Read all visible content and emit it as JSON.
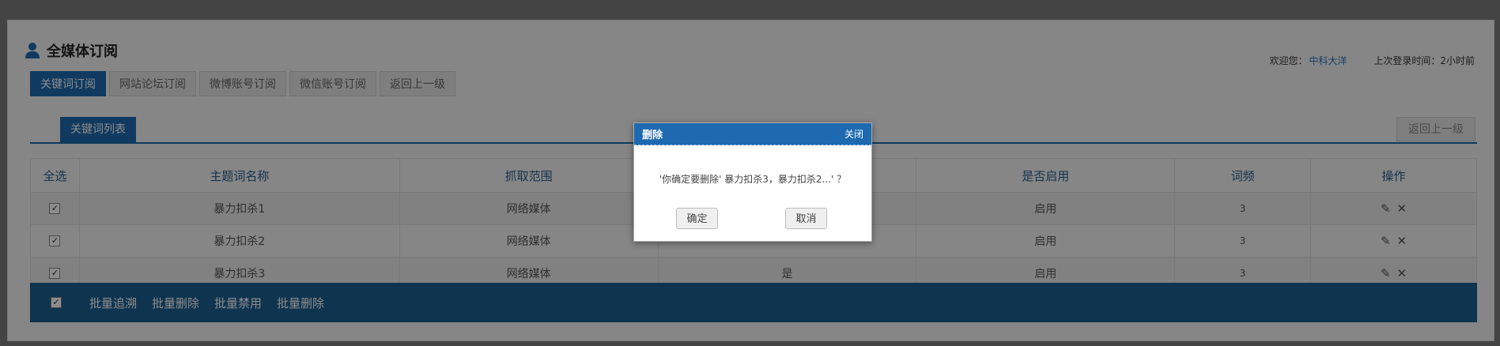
{
  "header": {
    "title": "全媒体订阅",
    "welcome_label": "欢迎您：",
    "username": "中科大洋",
    "last_login": "上次登录时间：2小时前"
  },
  "tabs": [
    {
      "label": "关键词订阅",
      "active": true
    },
    {
      "label": "网站论坛订阅",
      "active": false
    },
    {
      "label": "微博账号订阅",
      "active": false
    },
    {
      "label": "微信账号订阅",
      "active": false
    },
    {
      "label": "返回上一级",
      "active": false
    }
  ],
  "subbar": {
    "tab_label": "关键词列表",
    "back_label": "返回上一级"
  },
  "table": {
    "headers": [
      "全选",
      "主题词名称",
      "抓取范围",
      "",
      "是否启用",
      "词频",
      "操作"
    ],
    "rows": [
      {
        "checked": true,
        "name": "暴力扣杀1",
        "scope": "网络媒体",
        "col4": "",
        "enabled": "启用",
        "freq": "3"
      },
      {
        "checked": true,
        "name": "暴力扣杀2",
        "scope": "网络媒体",
        "col4": "",
        "enabled": "启用",
        "freq": "3"
      },
      {
        "checked": true,
        "name": "暴力扣杀3",
        "scope": "网络媒体",
        "col4": "是",
        "enabled": "启用",
        "freq": "3"
      }
    ],
    "check_mark": "✓",
    "edit_icon_glyph": "✎",
    "delete_icon_glyph": "✕"
  },
  "footer": {
    "actions": [
      "批量追溯",
      "批量删除",
      "批量禁用",
      "批量删除"
    ]
  },
  "dialog": {
    "title": "删除",
    "close_label": "关闭",
    "message": "'你确定要删除' 暴力扣杀3，暴力扣杀2...' ？",
    "ok_label": "确定",
    "cancel_label": "取消"
  },
  "colors": {
    "accent": "#1e6ab0",
    "footer_bar": "#1d5f92",
    "username": "#2a6fb0"
  }
}
